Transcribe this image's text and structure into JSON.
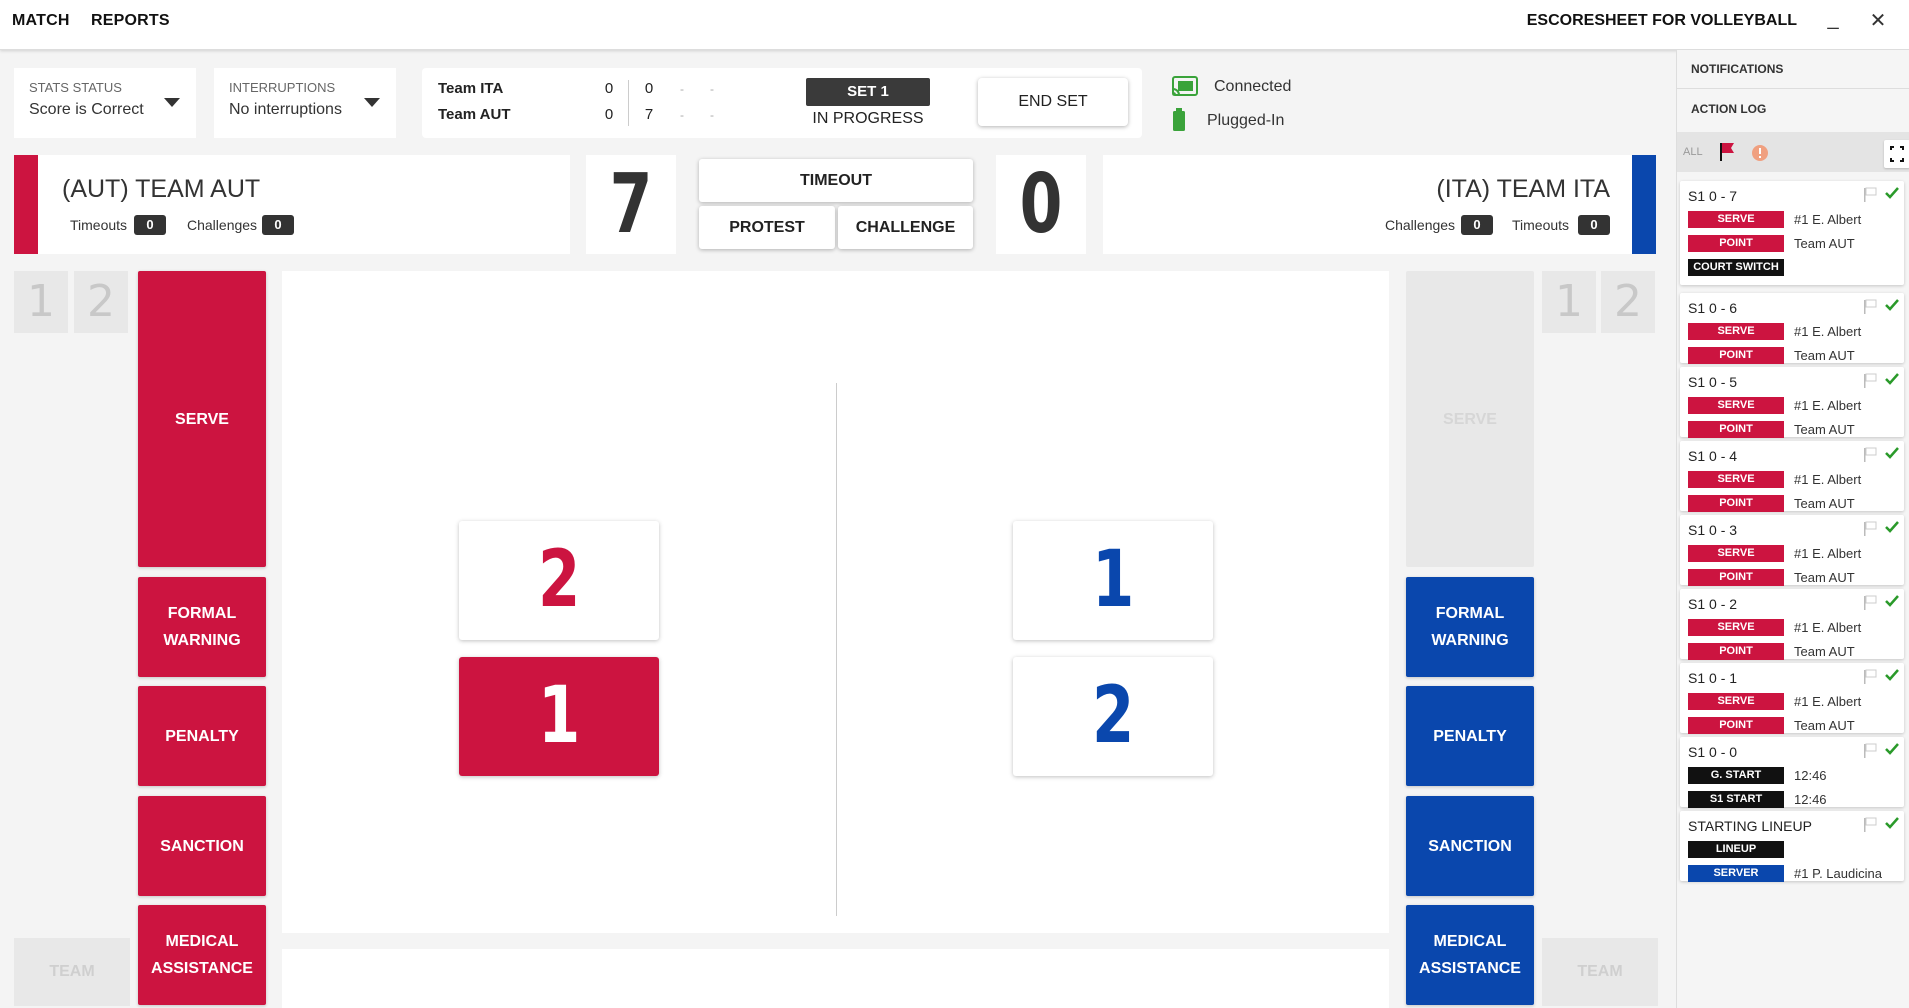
{
  "menu": {
    "match": "MATCH",
    "reports": "REPORTS"
  },
  "app_title": "ESCORESHEET FOR VOLLEYBALL",
  "window": {
    "minimize": "_",
    "close": "✕"
  },
  "stats_status": {
    "label": "STATS STATUS",
    "value": "Score is Correct"
  },
  "interruptions": {
    "label": "INTERRUPTIONS",
    "value": "No interruptions"
  },
  "scoreboard": {
    "team1": "Team ITA",
    "team2": "Team AUT",
    "team1_sets": "0",
    "team2_sets": "0",
    "team1_points": "0",
    "team2_points": "7",
    "dash": "-",
    "set_label": "SET 1",
    "status": "IN PROGRESS",
    "end_set": "END SET"
  },
  "connection": {
    "status": "Connected",
    "power": "Plugged-In"
  },
  "left_team": {
    "name": "(AUT) TEAM AUT",
    "timeouts_label": "Timeouts",
    "timeouts": "0",
    "challenges_label": "Challenges",
    "challenges": "0",
    "score": "7",
    "color": "#cc1440"
  },
  "right_team": {
    "name": "(ITA) TEAM ITA",
    "timeouts_label": "Timeouts",
    "timeouts": "0",
    "challenges_label": "Challenges",
    "challenges": "0",
    "score": "0",
    "color": "#0a47ad"
  },
  "center_buttons": {
    "timeout": "TIMEOUT",
    "protest": "PROTEST",
    "challenge": "CHALLENGE"
  },
  "set_boxes": {
    "one": "1",
    "two": "2"
  },
  "team_box": "TEAM",
  "actions": {
    "serve": "SERVE",
    "formal_warning_1": "FORMAL",
    "formal_warning_2": "WARNING",
    "penalty": "PENALTY",
    "sanction": "SANCTION",
    "medical_1": "MEDICAL",
    "medical_2": "ASSISTANCE"
  },
  "court": {
    "left_players": [
      "2",
      "1"
    ],
    "right_players": [
      "1",
      "2"
    ]
  },
  "sidebar": {
    "notifications": "NOTIFICATIONS",
    "action_log": "ACTION LOG",
    "filter_all": "ALL",
    "log": [
      {
        "title": "S1  0 - 7",
        "rows": [
          {
            "tag": "SERVE",
            "val": "#1 E. Albert"
          },
          {
            "tag": "POINT",
            "val": "Team AUT"
          },
          {
            "tag": "COURT SWITCH",
            "val": ""
          }
        ]
      },
      {
        "title": "S1  0 - 6",
        "rows": [
          {
            "tag": "SERVE",
            "val": "#1 E. Albert"
          },
          {
            "tag": "POINT",
            "val": "Team AUT"
          }
        ]
      },
      {
        "title": "S1  0 - 5",
        "rows": [
          {
            "tag": "SERVE",
            "val": "#1 E. Albert"
          },
          {
            "tag": "POINT",
            "val": "Team AUT"
          }
        ]
      },
      {
        "title": "S1  0 - 4",
        "rows": [
          {
            "tag": "SERVE",
            "val": "#1 E. Albert"
          },
          {
            "tag": "POINT",
            "val": "Team AUT"
          }
        ]
      },
      {
        "title": "S1  0 - 3",
        "rows": [
          {
            "tag": "SERVE",
            "val": "#1 E. Albert"
          },
          {
            "tag": "POINT",
            "val": "Team AUT"
          }
        ]
      },
      {
        "title": "S1  0 - 2",
        "rows": [
          {
            "tag": "SERVE",
            "val": "#1 E. Albert"
          },
          {
            "tag": "POINT",
            "val": "Team AUT"
          }
        ]
      },
      {
        "title": "S1  0 - 1",
        "rows": [
          {
            "tag": "SERVE",
            "val": "#1 E. Albert"
          },
          {
            "tag": "POINT",
            "val": "Team AUT"
          }
        ]
      },
      {
        "title": "S1  0 - 0",
        "rows": [
          {
            "tag": "G. START",
            "val": "12:46"
          },
          {
            "tag": "S1 START",
            "val": "12:46"
          }
        ]
      },
      {
        "title": "STARTING LINEUP",
        "rows": [
          {
            "tag": "LINEUP",
            "val": ""
          },
          {
            "tag": "SERVER",
            "val": "#1 P. Laudicina"
          }
        ]
      }
    ]
  }
}
